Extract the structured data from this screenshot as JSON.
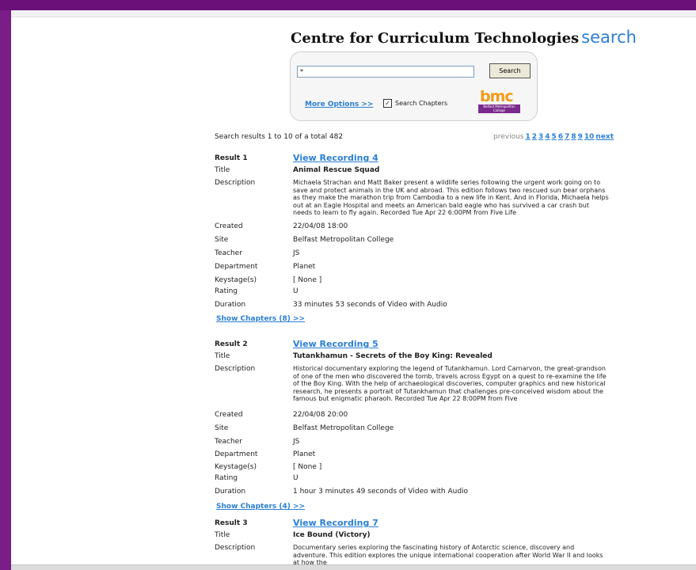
{
  "header": {
    "site_title": "Centre for Curriculum Technologies",
    "search_word": "search"
  },
  "search": {
    "query": "*",
    "button_label": "Search",
    "more_options": "More Options >>",
    "chapters_label": "Search Chapters",
    "chapters_checked": true
  },
  "logo": {
    "text": "bmc",
    "subtext": "Belfast Metropolitan College"
  },
  "results_summary": "Search results 1 to 10 of a total 482",
  "pagination": {
    "previous": "previous",
    "pages": [
      "1",
      "2",
      "3",
      "4",
      "5",
      "6",
      "7",
      "8",
      "9",
      "10"
    ],
    "next": "next"
  },
  "labels": {
    "title": "Title",
    "description": "Description",
    "created": "Created",
    "site": "Site",
    "teacher": "Teacher",
    "department": "Department",
    "keystage": "Keystage(s)",
    "rating": "Rating",
    "duration": "Duration"
  },
  "results": [
    {
      "label": "Result 1",
      "link": "View Recording 4",
      "title": "Animal Rescue Squad",
      "description": "Michaela Strachan and Matt Baker present a wildlife series following the urgent work going on to save and protect animals in the UK and abroad. This edition follows two rescued sun bear orphans as they make the marathon trip from Cambodia to a new life in Kent. And in Florida, Michaela helps out at an Eagle Hospital and meets an American bald eagle who has survived a car crash but needs to learn to fly again. Recorded Tue Apr 22 6:00PM from Five Life",
      "created": "22/04/08 18:00",
      "site": "Belfast Metropolitan College",
      "teacher": "JS",
      "department": "Planet",
      "keystage": "[ None ]",
      "rating": "U",
      "duration": "33 minutes 53 seconds of Video with Audio",
      "chapters": "Show Chapters (8) >>"
    },
    {
      "label": "Result 2",
      "link": "View Recording 5",
      "title": "Tutankhamun - Secrets of the Boy King: Revealed",
      "description": "Historical documentary exploring the legend of Tutankhamun. Lord Carnarvon, the great-grandson of one of the men who discovered the tomb, travels across Egypt on a quest to re-examine the life of the Boy King. With the help of archaeological discoveries, computer graphics and new historical research, he presents a portrait of Tutankhamun that challenges pre-conceived wisdom about the famous but enigmatic pharaoh. Recorded Tue Apr 22 8:00PM from Five",
      "created": "22/04/08 20:00",
      "site": "Belfast Metropolitan College",
      "teacher": "JS",
      "department": "Planet",
      "keystage": "[ None ]",
      "rating": "U",
      "duration": "1 hour 3 minutes 49 seconds of Video with Audio",
      "chapters": "Show Chapters (4) >>"
    },
    {
      "label": "Result 3",
      "link": "View Recording 7",
      "title": "Ice Bound (Victory)",
      "description": "Documentary series exploring the fascinating history of Antarctic science, discovery and adventure. This edition explores the unique international cooperation after World War II and looks at how the"
    }
  ]
}
